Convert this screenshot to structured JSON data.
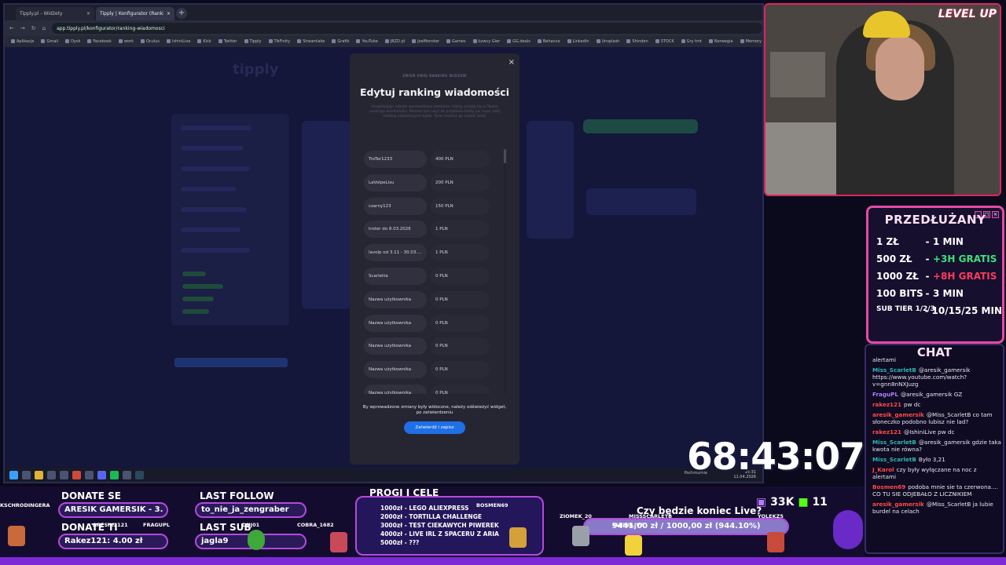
{
  "browser": {
    "tabs": [
      {
        "label": "Tipply.pl - Widżety",
        "active": false
      },
      {
        "label": "Tipply | Konfigurator (Ranking",
        "active": true
      }
    ],
    "url": "app.tipply.pl/konfigurator/ranking-wiadomosci",
    "bookmarks": [
      "Aplikacje",
      "Gmail",
      "Dysk",
      "Facebook",
      "work",
      "Oculus",
      "IshiniLive",
      "Kick",
      "Twitter",
      "Tipply",
      "TikFinity",
      "Streamlabs",
      "Grafik",
      "YouTube",
      "JBZD.pl",
      "JoeMonster",
      "Games",
      "Łowcy Gier",
      "GG.deals",
      "Behance",
      "LinkedIn",
      "Unsplash",
      "Shinden",
      "STOCK",
      "Gry tmt",
      "Norwegia",
      "Memory 5"
    ],
    "logo": "tipply"
  },
  "modal": {
    "kicker": "ZMIEŃ SWÓJ RANKING WIDZÓW",
    "title": "Edytuj ranking wiadomości",
    "description": "Uzupełniając rubryki wprowadzasz osobiście, którzy znajdą się w Twoim rankingu wiadomości. Możesz tym użyć do przykładu kiedy już masz swój ranking najwiekszych wpłat. Teraz możesz go ustalić tutaj!",
    "rows": [
      {
        "name": "TroTer1233",
        "amount": "400 PLN"
      },
      {
        "name": "LaVolpeLisu",
        "amount": "200 PLN"
      },
      {
        "name": "czarny123",
        "amount": "150 PLN"
      },
      {
        "name": "troter do 8.03.2026",
        "amount": "1 PLN"
      },
      {
        "name": "lavolp od 3.11 - 30.03....",
        "amount": "1 PLN"
      },
      {
        "name": "Scarletta",
        "amount": "0 PLN"
      },
      {
        "name": "Nazwa użytkownika",
        "amount": "0 PLN"
      },
      {
        "name": "Nazwa użytkownika",
        "amount": "0 PLN"
      },
      {
        "name": "Nazwa użytkownika",
        "amount": "0 PLN"
      },
      {
        "name": "Nazwa użytkownika",
        "amount": "0 PLN"
      },
      {
        "name": "Nazwa użytkownika",
        "amount": "0 PLN"
      }
    ],
    "notice": "By wprowadzone zmiany były widoczne, należy odświeżyć widget, po zatwierdzeniu",
    "confirm_label": "Zatwierdź i zapisz",
    "close": "×"
  },
  "taskbar": {
    "clock_time": "15:31",
    "clock_date": "11.04.2026",
    "weather": "Pochmurnie"
  },
  "camera": {
    "overlay_text": "LEVEL UP"
  },
  "extension": {
    "title": "PRZEDŁUŻANY",
    "rows": [
      {
        "left": "1 ZŁ",
        "right": "1 MIN",
        "color": "#ffffff"
      },
      {
        "left": "500 ZŁ",
        "right": "+3H GRATIS",
        "color": "#3fe07a"
      },
      {
        "left": "1000 ZŁ",
        "right": "+8H GRATIS",
        "color": "#ff3b5c"
      },
      {
        "left": "100 BITS",
        "right": "3 MIN",
        "color": "#ffffff"
      },
      {
        "left": "SUB TIER 1/2/3",
        "right": "10/15/25 MIN",
        "color": "#ffffff"
      }
    ]
  },
  "chat": {
    "title": "CHAT",
    "messages": [
      {
        "user": "",
        "text": "alertami",
        "color": "#e8e8f0"
      },
      {
        "user": "Miss_ScarletB",
        "text": "@aresik_gamersik https://www.youtube.com/watch?v=gnn8nNXJuzg",
        "color": "#2fb7b0"
      },
      {
        "user": "FraguPL",
        "text": "@aresik_gamersik GZ",
        "color": "#b27cff"
      },
      {
        "user": "rakez121",
        "text": "pw dc",
        "color": "#ff4a4a"
      },
      {
        "user": "aresik_gamersik",
        "text": "@Miss_ScarletB co tam słoneczko podobno lubisz nie lad?",
        "color": "#ff4a4a"
      },
      {
        "user": "rakez121",
        "text": "@IshiniLive pw dc",
        "color": "#ff4a4a"
      },
      {
        "user": "Miss_ScarletB",
        "text": "@aresik_gamersik gdzie taka kwota nie równa?",
        "color": "#2fb7b0"
      },
      {
        "user": "Miss_ScarletB",
        "text": "Było 3,21",
        "color": "#2fb7b0"
      },
      {
        "user": "J_Karol",
        "text": "czy były wyłączane na noc z alertami",
        "color": "#ff4a4a"
      },
      {
        "user": "Bosmen69",
        "text": "podoba mnie sie ta czerwona.... CO TU SIE ODJEBAŁO Z LICZNIKIEM",
        "color": "#ff4a4a"
      },
      {
        "user": "aresik_gamersik",
        "text": "@Miss_ScarletB ja lubie burdel na celach",
        "color": "#ff4a4a"
      }
    ]
  },
  "timer": "68:43:07",
  "bottom": {
    "donate_label": "DONATE SE",
    "donate_value": "ARESIK GAMERSIK - 3.",
    "donate_tip_label": "DONATE TI",
    "donate_tip_value": "Rakez121: 4.00 zł",
    "last_follow_label": "LAST FOLLOW",
    "last_follow_value": "to_nie_ja_zengraber",
    "last_sub_label": "LAST SUB",
    "last_sub_value": "jagla9",
    "goals_label": "PROGI I CELE",
    "goals": [
      "1000zł - LEGO ALIEXPRESS",
      "2000zł - TORTILLA CHALLENGE",
      "3000zł - TEST CIEKAWYCH PIWEREK",
      "4000zł - LIVE IRL Z SPACERU Z ARIA",
      "5000zł - ???"
    ],
    "question": "Czy będzie koniec Live?",
    "progress_text": "9441,00 zł / 1000,00 zł (944.10%)",
    "progress_fraction": 1.0,
    "followers_count": "33K",
    "subs_count": "11",
    "nicknames": [
      "KSCHRODINGERA",
      "ARESIK2121",
      "FRAGUPL",
      "BOSMEN69",
      "ZIOMEK_20",
      "MISSSCARLETB",
      "YOLEKZ5",
      "DUJ01",
      "COBRA_1682",
      "ISHINILIVE"
    ]
  }
}
